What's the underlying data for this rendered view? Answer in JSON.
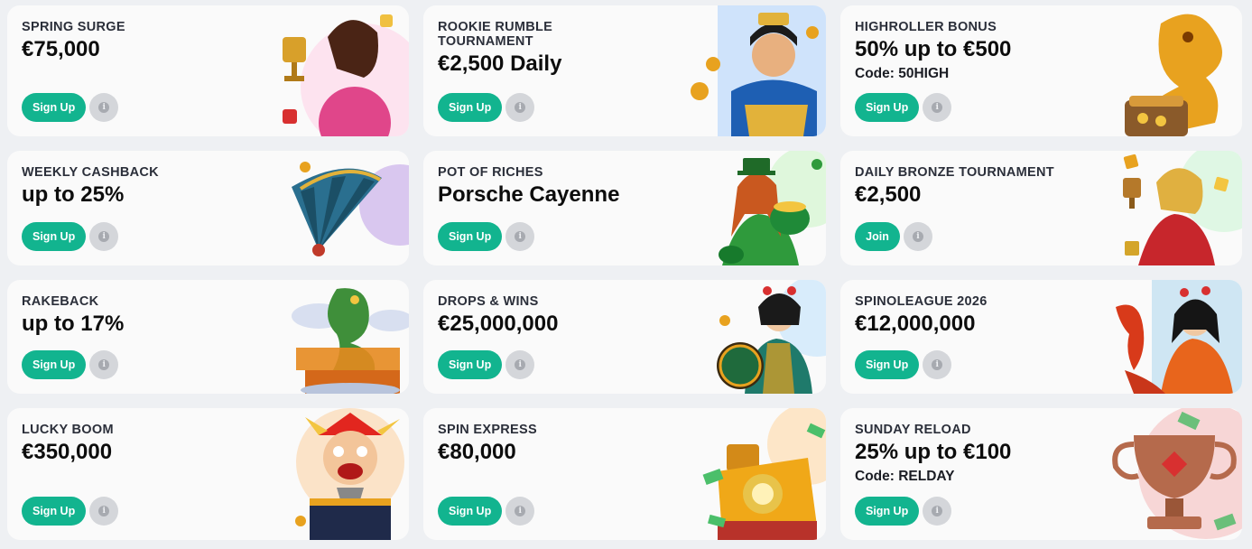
{
  "cards": [
    {
      "label": "SPRING SURGE",
      "value": "€75,000",
      "code": "",
      "button": "Sign Up",
      "art": "woman-trophy-illustration",
      "accent": "#e0468a"
    },
    {
      "label": "ROOKIE RUMBLE TOURNAMENT",
      "value": "€2,500 Daily",
      "code": "",
      "button": "Sign Up",
      "art": "warrior-illustration",
      "accent": "#1e5fb3"
    },
    {
      "label": "HIGHROLLER BONUS",
      "value": "50% up to €500",
      "code": "Code: 50HIGH",
      "button": "Sign Up",
      "art": "golden-dragon-illustration",
      "accent": "#e8a21f"
    },
    {
      "label": "WEEKLY CASHBACK",
      "value": "up to 25%",
      "code": "",
      "button": "Sign Up",
      "art": "cashback-fan-illustration",
      "accent": "#2a6f8f"
    },
    {
      "label": "POT OF RICHES",
      "value": "Porsche Cayenne",
      "code": "",
      "button": "Sign Up",
      "art": "leprechaun-girl-illustration",
      "accent": "#2f9a3c"
    },
    {
      "label": "DAILY BRONZE TOURNAMENT",
      "value": "€2,500",
      "code": "",
      "button": "Join",
      "art": "woman-red-dress-illustration",
      "accent": "#c7262c"
    },
    {
      "label": "RAKEBACK",
      "value": "up to 17%",
      "code": "",
      "button": "Sign Up",
      "art": "rakeback-dragon-illustration",
      "accent": "#3f8f3a"
    },
    {
      "label": "DROPS & WINS",
      "value": "€25,000,000",
      "code": "",
      "button": "Sign Up",
      "art": "geisha-drops-wins-illustration",
      "accent": "#1f7a6b"
    },
    {
      "label": "SPINOLEAGUE 2026",
      "value": "€12,000,000",
      "code": "",
      "button": "Sign Up",
      "art": "woman-dragon-illustration",
      "accent": "#e8651c"
    },
    {
      "label": "LUCKY BOOM",
      "value": "€350,000",
      "code": "",
      "button": "Sign Up",
      "art": "jester-box-illustration",
      "accent": "#e2261f"
    },
    {
      "label": "SPIN EXPRESS",
      "value": "€80,000",
      "code": "",
      "button": "Sign Up",
      "art": "gold-train-illustration",
      "accent": "#f0a818"
    },
    {
      "label": "SUNDAY RELOAD",
      "value": "25% up to €100",
      "code": "Code: RELDAY",
      "button": "Sign Up",
      "art": "trophy-cup-illustration",
      "accent": "#b56a4c"
    }
  ]
}
